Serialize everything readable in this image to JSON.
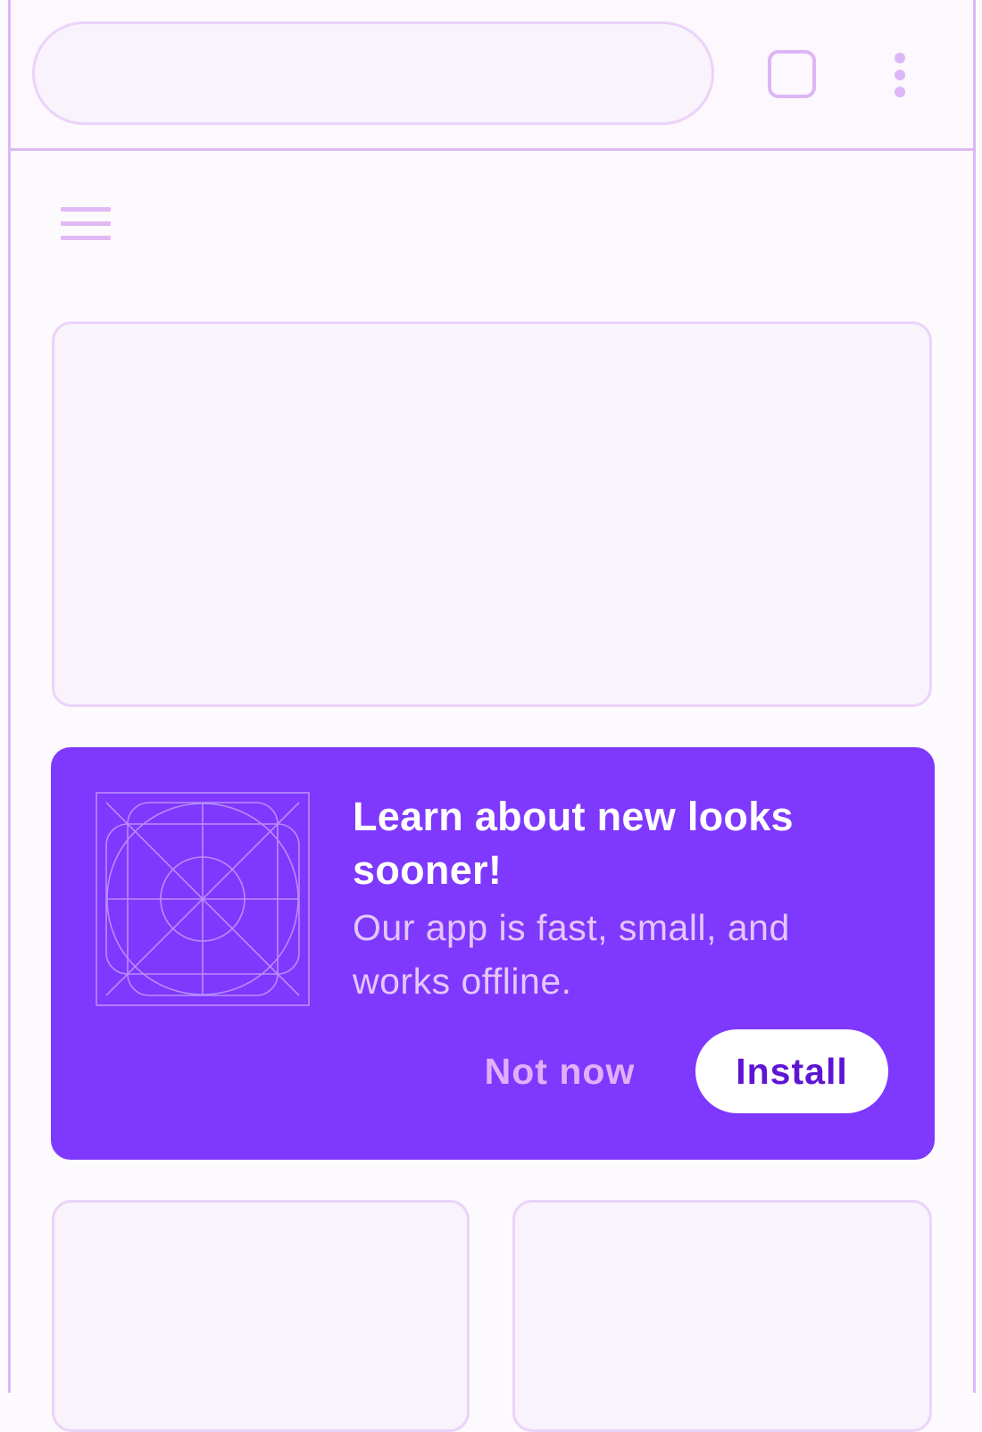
{
  "toolbar": {
    "url_value": "",
    "tabs_icon": "tab-switcher-icon",
    "menu_icon": "more-vertical-icon"
  },
  "page": {
    "nav_icon": "hamburger-menu-icon"
  },
  "install_prompt": {
    "title": "Learn about new looks sooner!",
    "description": "Our app is fast, small, and works offline.",
    "icon": "app-icon-placeholder",
    "dismiss_label": "Not now",
    "install_label": "Install",
    "background_color": "#7f38fd",
    "install_text_color": "#5e15d3"
  },
  "colors": {
    "accent_outline": "#dcb8f5",
    "placeholder_fill": "#f9f3fc"
  }
}
